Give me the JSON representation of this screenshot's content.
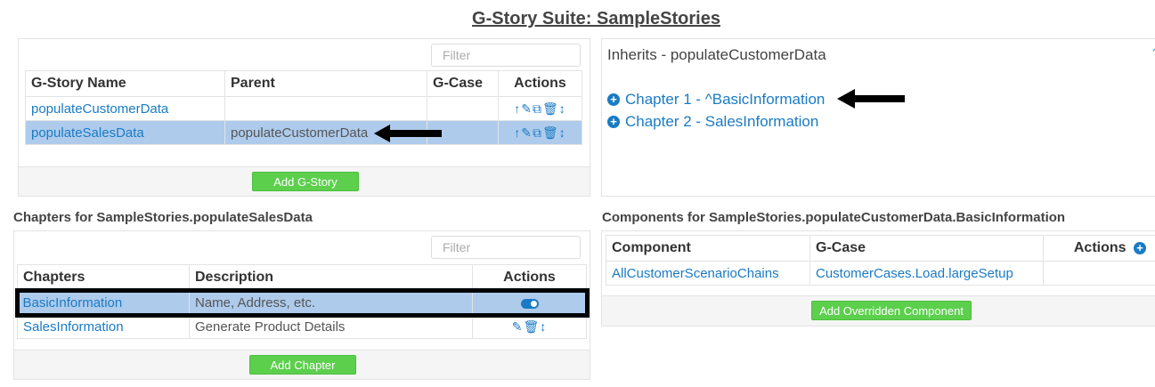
{
  "page": {
    "title": "G-Story Suite: SampleStories"
  },
  "stories_panel": {
    "filter_placeholder": "Filter",
    "columns": [
      "G-Story Name",
      "Parent",
      "G-Case",
      "Actions"
    ],
    "rows": [
      {
        "name": "populateCustomerData",
        "parent": "",
        "gcase": "",
        "selected": false
      },
      {
        "name": "populateSalesData",
        "parent": "populateCustomerData",
        "gcase": "",
        "selected": true
      }
    ],
    "add_button": "Add G-Story"
  },
  "inherits_panel": {
    "heading": "Inherits - populateCustomerData",
    "chapters": [
      "Chapter 1 - ^BasicInformation",
      "Chapter 2 - SalesInformation"
    ],
    "expand_icon": "expand-icon"
  },
  "chapters_section": {
    "label": "Chapters for SampleStories.populateSalesData",
    "filter_placeholder": "Filter",
    "columns": [
      "Chapters",
      "Description",
      "Actions"
    ],
    "rows": [
      {
        "name": "BasicInformation",
        "description": "Name, Address, etc.",
        "selected": true
      },
      {
        "name": "SalesInformation",
        "description": "Generate Product Details",
        "selected": false
      }
    ],
    "add_button": "Add Chapter"
  },
  "components_section": {
    "label": "Components for SampleStories.populateCustomerData.BasicInformation",
    "columns": [
      "Component",
      "G-Case",
      "Actions"
    ],
    "rows": [
      {
        "component": "AllCustomerScenarioChains",
        "gcase": "CustomerCases.Load.largeSetup"
      }
    ],
    "add_button": "Add Overridden Component"
  },
  "colors": {
    "link": "#1a7bc4",
    "selected_row": "#aecbec",
    "green_button": "#5ccf4d"
  }
}
